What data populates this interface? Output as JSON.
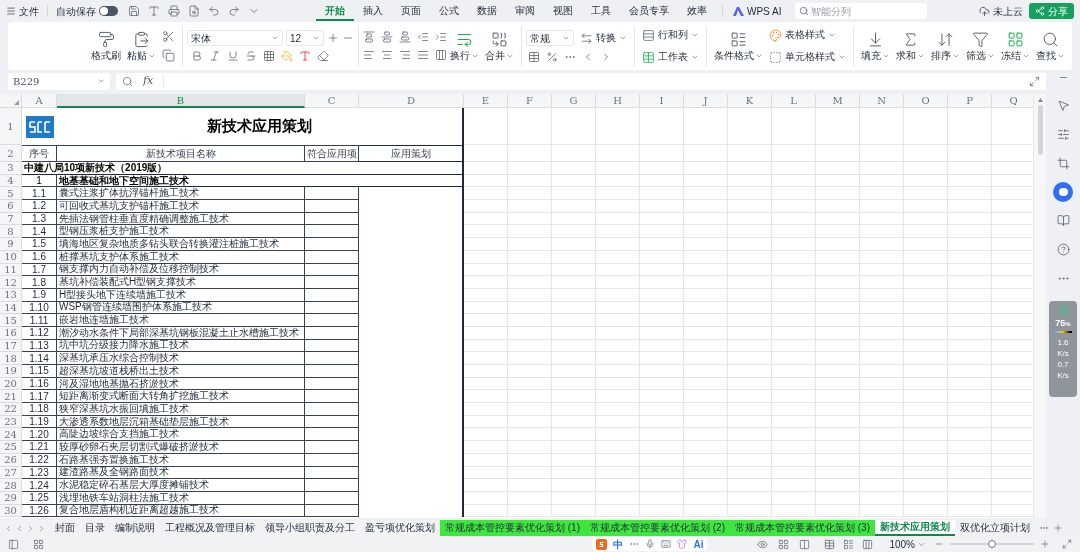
{
  "app_bar": {
    "file_menu": "文件",
    "autosave": {
      "label": "自动保存",
      "on": false
    },
    "tabs": [
      {
        "label": "开始",
        "selected": true
      },
      {
        "label": "插入",
        "selected": false
      },
      {
        "label": "页面",
        "selected": false
      },
      {
        "label": "公式",
        "selected": false
      },
      {
        "label": "数据",
        "selected": false
      },
      {
        "label": "审阅",
        "selected": false
      },
      {
        "label": "视图",
        "selected": false
      },
      {
        "label": "工具",
        "selected": false
      },
      {
        "label": "会员专享",
        "selected": false
      },
      {
        "label": "效率",
        "selected": false
      }
    ],
    "ai": "WPS AI",
    "search": {
      "placeholder": "智能分列"
    },
    "cloud": "未上云",
    "share": "分享"
  },
  "ribbon": {
    "format_painter": "格式刷",
    "paste": "粘贴",
    "font": "宋体",
    "font_size": "12",
    "wrap": "换行",
    "merge": "合并",
    "number_format": "常规",
    "convert": "转换",
    "rows_cols": "行和列",
    "worksheet": "工作表",
    "cond_format": "条件格式",
    "table_style": "表格样式",
    "cell_style": "单元格样式",
    "tools": [
      "填充",
      "求和",
      "排序",
      "筛选",
      "冻结",
      "查找"
    ]
  },
  "formula_bar": {
    "name_box": "B229",
    "fx": "fx"
  },
  "columns": [
    {
      "label": "A",
      "selected": false
    },
    {
      "label": "B",
      "selected": true
    },
    {
      "label": "C",
      "selected": false
    },
    {
      "label": "D",
      "selected": false
    },
    {
      "label": "E",
      "selected": false
    },
    {
      "label": "F",
      "selected": false
    },
    {
      "label": "G",
      "selected": false
    },
    {
      "label": "H",
      "selected": false
    },
    {
      "label": "I",
      "selected": false
    },
    {
      "label": "J",
      "selected": false
    },
    {
      "label": "K",
      "selected": false
    },
    {
      "label": "L",
      "selected": false
    },
    {
      "label": "M",
      "selected": false
    },
    {
      "label": "N",
      "selected": false
    },
    {
      "label": "O",
      "selected": false
    },
    {
      "label": "P",
      "selected": false
    },
    {
      "label": "Q",
      "selected": false
    }
  ],
  "rows": [
    {
      "kind": "title",
      "row": "1",
      "title": "新技术应用策划"
    },
    {
      "kind": "header",
      "row": "2",
      "cells": [
        "序号",
        "新技术项目名称",
        "符合应用项",
        "应用策划"
      ]
    },
    {
      "kind": "section",
      "row": "3",
      "text": "中建八局10项新技术（2019版）"
    },
    {
      "kind": "group",
      "row": "4",
      "no": "1",
      "name": "地基基础和地下空间施工技术"
    },
    {
      "kind": "item",
      "row": "5",
      "no": "1.1",
      "name": "囊式注浆扩体抗浮锚杆施工技术"
    },
    {
      "kind": "item",
      "row": "6",
      "no": "1.2",
      "name": "可回收式基坑支护锚杆施工技术"
    },
    {
      "kind": "item",
      "row": "7",
      "no": "1.3",
      "name": "先插法钢管柱垂直度精确调整施工技术"
    },
    {
      "kind": "item",
      "row": "8",
      "no": "1.4",
      "name": "型钢压浆桩支护施工技术"
    },
    {
      "kind": "item",
      "row": "9",
      "no": "1.5",
      "name": "填海地区复杂地质多钻头联合转换灌注桩施工技术"
    },
    {
      "kind": "item",
      "row": "10",
      "no": "1.6",
      "name": "桩撑基坑支护体系施工技术"
    },
    {
      "kind": "item",
      "row": "11",
      "no": "1.7",
      "name": "钢支撑内力自动补偿及位移控制技术"
    },
    {
      "kind": "item",
      "row": "12",
      "no": "1.8",
      "name": "基坑补偿装配式H型钢支撑技术"
    },
    {
      "kind": "item",
      "row": "13",
      "no": "1.9",
      "name": "H型接头地下连续墙施工技术"
    },
    {
      "kind": "item",
      "row": "14",
      "no": "1.10",
      "name": "WSP钢管连续墙围护体系施工技术"
    },
    {
      "kind": "item",
      "row": "15",
      "no": "1.11",
      "name": "嵌岩地连墙施工技术"
    },
    {
      "kind": "item",
      "row": "16",
      "no": "1.12",
      "name": "潮汐动水条件下局部深基坑钢板混凝土止水槽施工技术"
    },
    {
      "kind": "item",
      "row": "17",
      "no": "1.13",
      "name": "坑中坑分级接力降水施工技术"
    },
    {
      "kind": "item",
      "row": "18",
      "no": "1.14",
      "name": "深基坑承压水综合控制技术"
    },
    {
      "kind": "item",
      "row": "19",
      "no": "1.15",
      "name": "超深基坑坡道栈桥出土技术"
    },
    {
      "kind": "item",
      "row": "20",
      "no": "1.16",
      "name": "河及湿地地基抛石挤淤技术"
    },
    {
      "kind": "item",
      "row": "21",
      "no": "1.17",
      "name": "短距离渐变式断面大转角扩挖施工技术"
    },
    {
      "kind": "item",
      "row": "22",
      "no": "1.18",
      "name": "狭窄深基坑水振回填施工技术"
    },
    {
      "kind": "item",
      "row": "23",
      "no": "1.19",
      "name": "大渗透系数地层沉箱基础垫层施工技术"
    },
    {
      "kind": "item",
      "row": "24",
      "no": "1.20",
      "name": "高陡边坡综合支挡施工技术"
    },
    {
      "kind": "item",
      "row": "25",
      "no": "1.21",
      "name": "较厚砂卵石夹层切割式爆破挤淤技术"
    },
    {
      "kind": "item",
      "row": "26",
      "no": "1.22",
      "name": "石路基强夯置换施工技术"
    },
    {
      "kind": "item",
      "row": "27",
      "no": "1.23",
      "name": "建渣路基及全钢路面技术"
    },
    {
      "kind": "item",
      "row": "28",
      "no": "1.24",
      "name": "水泥稳定碎石基层大厚度摊铺技术"
    },
    {
      "kind": "item",
      "row": "29",
      "no": "1.25",
      "name": "浅埋地铁车站洞柱法施工技术"
    },
    {
      "kind": "item",
      "row": "30",
      "no": "1.26",
      "name": "复合地层盾构机近距离超越施工技术"
    }
  ],
  "sheet_tabs": [
    {
      "label": "封面",
      "selected": false
    },
    {
      "label": "目录",
      "selected": false
    },
    {
      "label": "编制说明",
      "selected": false
    },
    {
      "label": "工程概况及管理目标",
      "selected": false
    },
    {
      "label": "领导小组职责及分工",
      "selected": false
    },
    {
      "label": "盈亏项优化策划",
      "selected": false
    },
    {
      "label": "常规成本管控要素优化策划 (1)",
      "selected": false,
      "color": "#3ee63e"
    },
    {
      "label": "常规成本管控要素优化策划 (2)",
      "selected": false,
      "color": "#3ee63e"
    },
    {
      "label": "常规成本管控要素优化策划 (3)",
      "selected": false,
      "color": "#3ee63e"
    },
    {
      "label": "新技术应用策划",
      "selected": true
    },
    {
      "label": "双优化立项计划",
      "selected": false
    }
  ],
  "monitor": {
    "score": "75",
    "score_unit": "%",
    "up": "1.6",
    "up_unit": "K/s",
    "down": "0.7",
    "down_unit": "K/s"
  },
  "status_bar": {
    "ime_lang": "中",
    "ime_ai": "Ai",
    "zoom": "100%",
    "zoom_slider": {
      "level": 0.5
    }
  }
}
